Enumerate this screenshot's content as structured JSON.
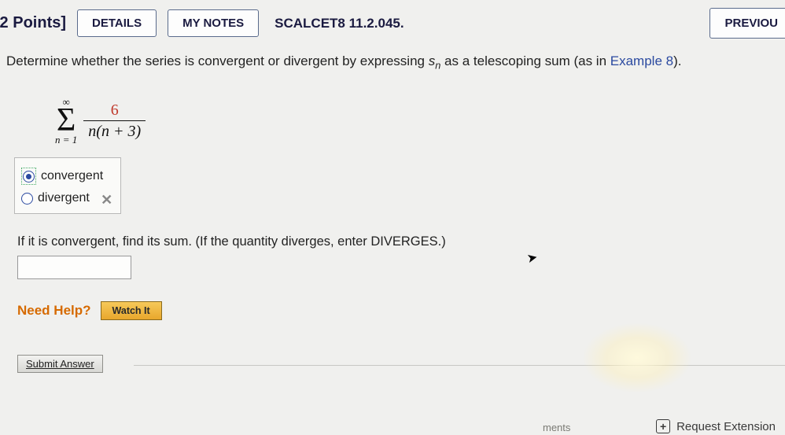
{
  "toolbar": {
    "points": "/2 Points]",
    "details": "DETAILS",
    "my_notes": "MY NOTES",
    "reference": "SCALCET8 11.2.045.",
    "previous": "PREVIOU"
  },
  "question": {
    "prompt_pre": "Determine whether the series is convergent or divergent by expressing ",
    "s_var": "s",
    "s_sub": "n",
    "prompt_mid": " as a telescoping sum (as in ",
    "example_link": "Example 8",
    "prompt_post": ")."
  },
  "series": {
    "upper": "∞",
    "lower": "n = 1",
    "numerator": "6",
    "denominator": "n(n + 3)"
  },
  "options": {
    "convergent": "convergent",
    "divergent": "divergent",
    "selected": "convergent",
    "feedback": "✕"
  },
  "sum": {
    "prompt": "If it is convergent, find its sum. (If the quantity diverges, enter DIVERGES.)",
    "value": ""
  },
  "help": {
    "label": "Need Help?",
    "watch": "Watch It"
  },
  "submit": {
    "label": "Submit Answer"
  },
  "footer": {
    "request": "Request Extension",
    "ments": "ments"
  },
  "chart_data": {
    "type": "table",
    "title": "Series convergence question",
    "series_expression": "Σ_{n=1}^{∞} 6 / (n(n+3))",
    "choices": [
      "convergent",
      "divergent"
    ],
    "selected_choice": "convergent",
    "selection_marked": "incorrect",
    "sum_input": ""
  }
}
